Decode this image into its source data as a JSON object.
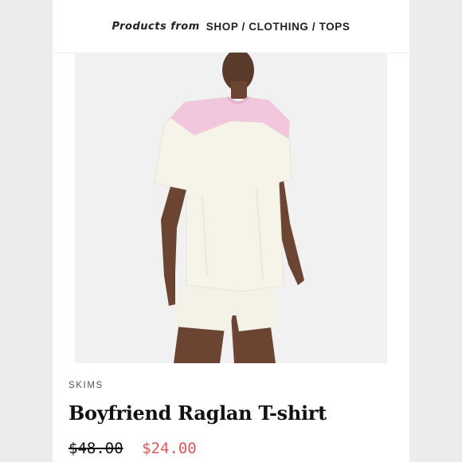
{
  "breadcrumb": {
    "prefix": "Products from",
    "path": "SHOP / CLOTHING / TOPS"
  },
  "product": {
    "brand": "SKIMS",
    "title": "Boyfriend Raglan T-shirt",
    "original_price": "$48.00",
    "sale_price": "$24.00",
    "image_icon": "product-photo-model-raglan-tshirt"
  },
  "colors": {
    "sale_price": "#e0575b",
    "shirt_body": "#f6f3e8",
    "shirt_yoke": "#f2c6dc",
    "background": "#ececec"
  }
}
